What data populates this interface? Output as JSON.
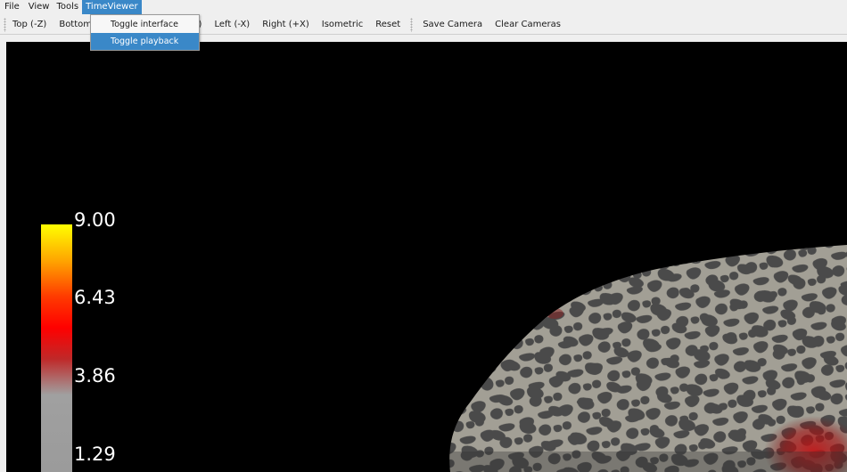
{
  "menubar": {
    "items": [
      {
        "label": "File"
      },
      {
        "label": "View"
      },
      {
        "label": "Tools"
      },
      {
        "label": "TimeViewer"
      }
    ]
  },
  "toolbar": {
    "buttons": [
      {
        "label": "Top (-Z)"
      },
      {
        "label": "Bottom"
      },
      {
        "label": "-Y)"
      },
      {
        "label": "Left (-X)"
      },
      {
        "label": "Right (+X)"
      },
      {
        "label": "Isometric"
      },
      {
        "label": "Reset"
      },
      {
        "label": "Save Camera"
      },
      {
        "label": "Clear Cameras"
      }
    ]
  },
  "dropdown": {
    "items": [
      {
        "label": "Toggle interface",
        "highlighted": false
      },
      {
        "label": "Toggle playback",
        "highlighted": true
      }
    ]
  },
  "colorbar": {
    "labels": [
      "9.00",
      "6.43",
      "3.86",
      "1.29"
    ],
    "colors": [
      "#ffff00",
      "#ff0000",
      "#9a9a9a"
    ]
  },
  "colors": {
    "accent": "#3a88c8",
    "viewport_bg": "#000000",
    "brain_light": "#a29f95",
    "brain_dark": "#4a4a4a",
    "activation": "#c0181a"
  }
}
